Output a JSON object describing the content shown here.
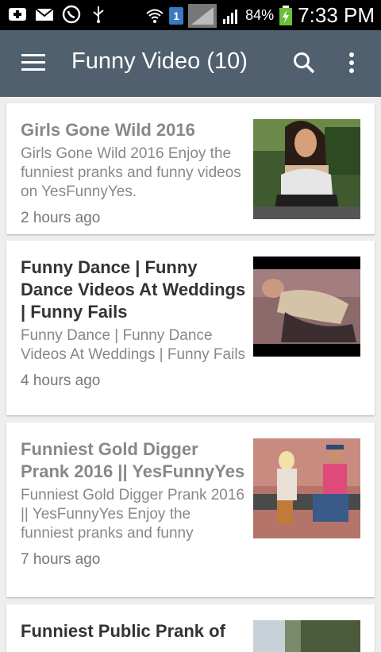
{
  "status_bar": {
    "sim_badge": "1",
    "battery_percent": "84%",
    "time": "7:33 PM"
  },
  "app_bar": {
    "title": "Funny Video (10)",
    "menu_icon": "hamburger-icon",
    "search_icon": "search-icon",
    "more_icon": "more-vert-icon"
  },
  "videos": [
    {
      "title": "Girls Gone Wild 2016",
      "description": "Girls Gone Wild 2016 Enjoy the funniest pranks and funny videos on YesFunnyYes.",
      "time": "2 hours ago",
      "read": true
    },
    {
      "title": "Funny Dance | Funny Dance Videos At Weddings | Funny Fails",
      "description": "Funny Dance | Funny Dance Videos At Weddings | Funny Fails",
      "time": "4 hours ago",
      "read": false
    },
    {
      "title": "Funniest Gold Digger Prank 2016 || YesFunnyYes",
      "description": "Funniest Gold Digger Prank 2016 || YesFunnyYes Enjoy the funniest pranks and funny",
      "time": "7 hours ago",
      "read": true
    },
    {
      "title": "Funniest Public Prank of",
      "description": "",
      "time": "",
      "read": false
    }
  ]
}
